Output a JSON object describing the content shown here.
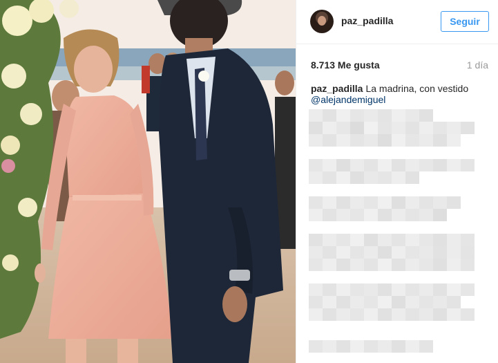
{
  "post": {
    "username": "paz_padilla",
    "follow_label": "Seguir",
    "likes": "8.713 Me gusta",
    "time_ago": "1 día",
    "caption_user": "paz_padilla",
    "caption_text": "La madrina, con vestido",
    "mention": "@alejandemiguel"
  },
  "colors": {
    "accent": "#3897f0",
    "mention": "#003569",
    "text": "#262626",
    "muted": "#999999"
  }
}
